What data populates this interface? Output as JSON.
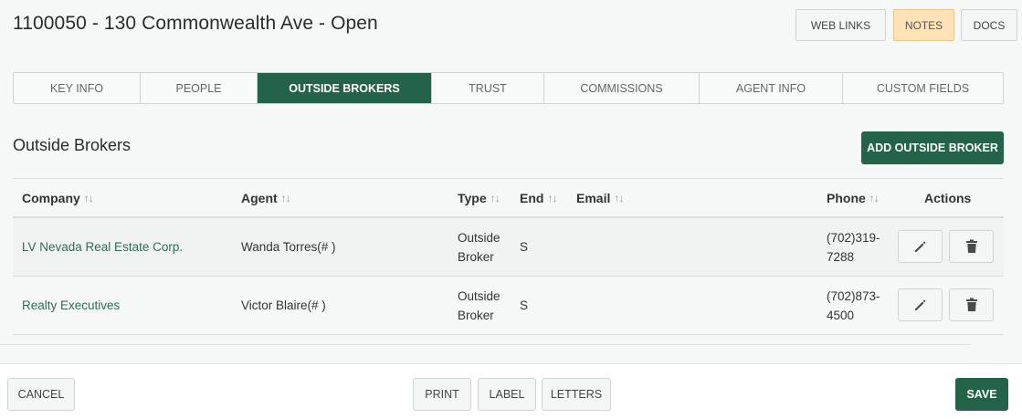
{
  "header": {
    "title": "1100050 - 130 Commonwealth Ave - Open",
    "web_links": "WEB LINKS",
    "notes": "NOTES",
    "docs": "DOCS"
  },
  "tabs": [
    "KEY INFO",
    "PEOPLE",
    "OUTSIDE BROKERS",
    "TRUST",
    "COMMISSIONS",
    "AGENT INFO",
    "CUSTOM FIELDS"
  ],
  "active_tab": "OUTSIDE BROKERS",
  "section": {
    "title": "Outside Brokers",
    "add_button": "ADD OUTSIDE BROKER"
  },
  "table": {
    "columns": {
      "company": "Company",
      "agent": "Agent",
      "type": "Type",
      "end": "End",
      "email": "Email",
      "phone": "Phone",
      "actions": "Actions"
    },
    "sort_glyph": "↑↓",
    "rows": [
      {
        "company": "LV Nevada Real Estate Corp.",
        "agent": "Wanda Torres(# )",
        "type": "Outside Broker",
        "end": "S",
        "email": "",
        "phone": "(702)319-7288"
      },
      {
        "company": "Realty Executives",
        "agent": "Victor Blaire(# )",
        "type": "Outside Broker",
        "end": "S",
        "email": "",
        "phone": "(702)873-4500"
      }
    ]
  },
  "footer": {
    "cancel": "CANCEL",
    "print": "PRINT",
    "label": "LABEL",
    "letters": "LETTERS",
    "save": "SAVE"
  },
  "colors": {
    "primary": "#23634a",
    "notes_bg": "#ffe2b5",
    "link": "#2f6d54"
  },
  "icons": {
    "edit": "pencil-icon",
    "delete": "trash-icon"
  }
}
